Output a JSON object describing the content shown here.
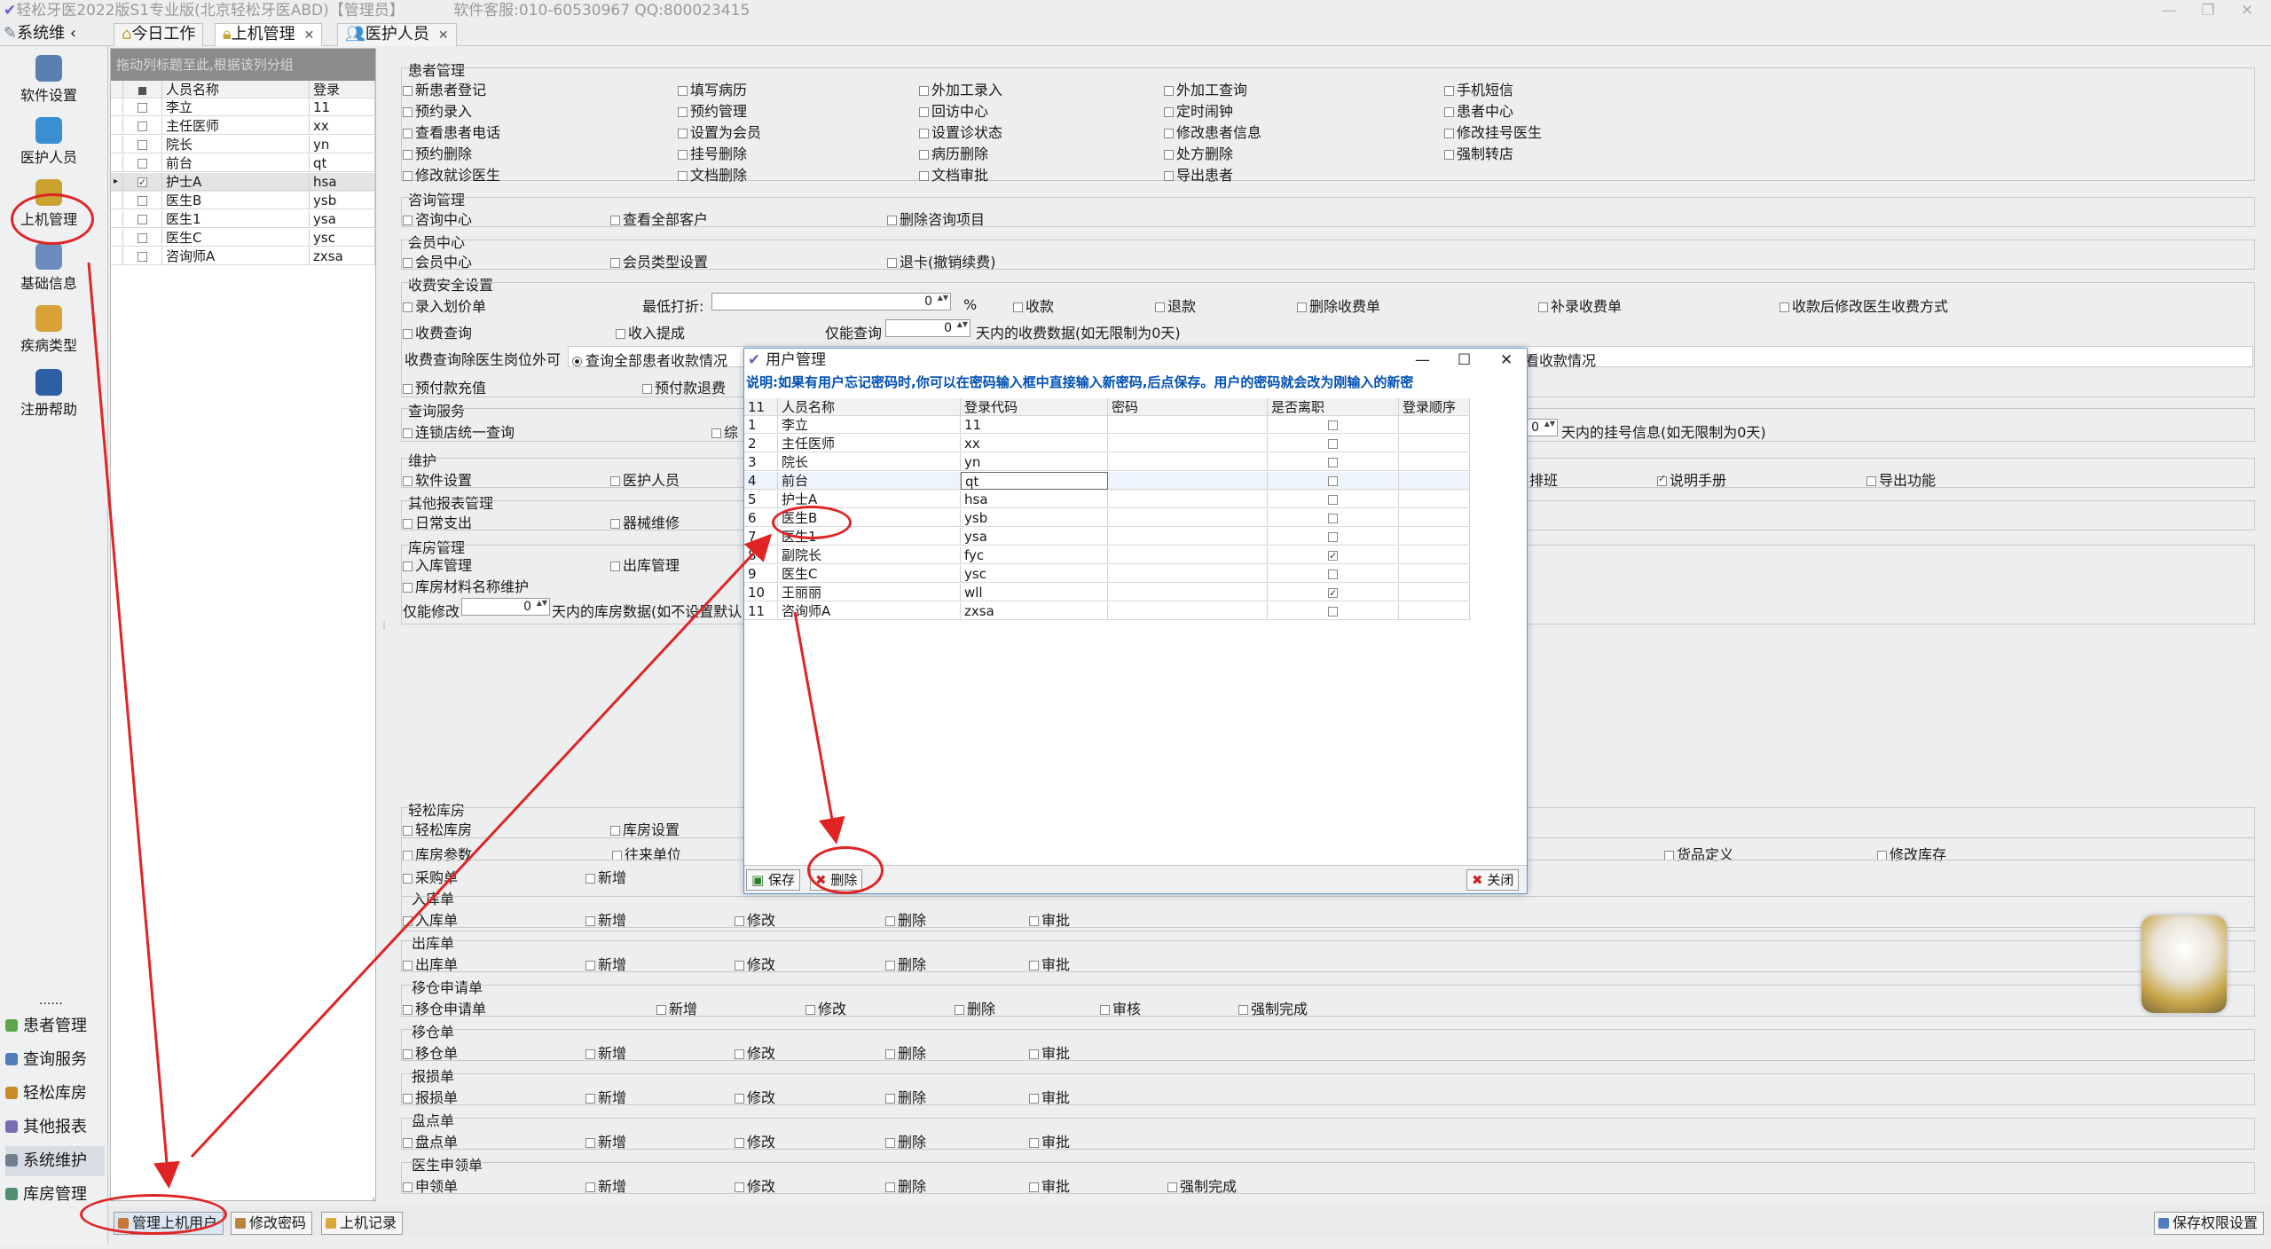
{
  "app": {
    "title": "轻松牙医2022版S1专业版(北京轻松牙医ABD)【管理员】",
    "service": "软件客服:010-60530967 QQ:800023415",
    "tabs_head": "系统维",
    "tabs": [
      {
        "label": "今日工作",
        "closable": false
      },
      {
        "label": "上机管理",
        "closable": true
      },
      {
        "label": "医护人员",
        "closable": true
      }
    ],
    "window_controls": [
      "—",
      "❐",
      "✕"
    ]
  },
  "nav": {
    "top_items": [
      {
        "label": "软件设置",
        "icon": "gear-icon",
        "color": "#5a7fb0"
      },
      {
        "label": "医护人员",
        "icon": "users-icon",
        "color": "#3b8fd1"
      },
      {
        "label": "上机管理",
        "icon": "lock-icon",
        "color": "#c9a230"
      },
      {
        "label": "基础信息",
        "icon": "database-gear-icon",
        "color": "#6a8bbd"
      },
      {
        "label": "疾病类型",
        "icon": "boxes-icon",
        "color": "#d9a236"
      },
      {
        "label": "注册帮助",
        "icon": "help-icon",
        "color": "#2c5fa4"
      }
    ],
    "more": "......",
    "bottom_items": [
      {
        "label": "患者管理",
        "icon": "patients-icon",
        "color": "#5ea34a"
      },
      {
        "label": "查询服务",
        "icon": "search-icon",
        "color": "#4f7bbf"
      },
      {
        "label": "轻松库房",
        "icon": "warehouse-icon",
        "color": "#c98b2a"
      },
      {
        "label": "其他报表",
        "icon": "report-icon",
        "color": "#7b6bb0"
      },
      {
        "label": "系统维护",
        "icon": "tools-icon",
        "color": "#6f7f8f"
      },
      {
        "label": "库房管理",
        "icon": "inventory-icon",
        "color": "#4f8f6f"
      }
    ]
  },
  "userlist": {
    "group_hint": "拖动列标题至此,根据该列分组",
    "headers": [
      "人员名称",
      "登录"
    ],
    "rows": [
      {
        "name": "李立",
        "code": "11",
        "checked": false
      },
      {
        "name": "主任医师",
        "code": "xx",
        "checked": false
      },
      {
        "name": "院长",
        "code": "yn",
        "checked": false
      },
      {
        "name": "前台",
        "code": "qt",
        "checked": false
      },
      {
        "name": "护士A",
        "code": "hsa",
        "checked": true
      },
      {
        "name": "医生B",
        "code": "ysb",
        "checked": false
      },
      {
        "name": "医生1",
        "code": "ysa",
        "checked": false
      },
      {
        "name": "医生C",
        "code": "ysc",
        "checked": false
      },
      {
        "name": "咨询师A",
        "code": "zxsa",
        "checked": false
      }
    ]
  },
  "perms": {
    "patient": {
      "title": "患者管理",
      "rows": [
        [
          "新患者登记",
          "填写病历",
          "外加工录入",
          "外加工查询",
          "手机短信"
        ],
        [
          "预约录入",
          "预约管理",
          "回访中心",
          "定时闹钟",
          "患者中心"
        ],
        [
          "查看患者电话",
          "设置为会员",
          "设置诊状态",
          "修改患者信息",
          "修改挂号医生"
        ],
        [
          "预约删除",
          "挂号删除",
          "病历删除",
          "处方删除",
          "强制转店"
        ],
        [
          "修改就诊医生",
          "文档删除",
          "文档审批",
          "导出患者",
          ""
        ]
      ]
    },
    "consult": {
      "title": "咨询管理",
      "items": [
        "咨询中心",
        "查看全部客户",
        "删除咨询项目"
      ]
    },
    "member": {
      "title": "会员中心",
      "items": [
        "会员中心",
        "会员类型设置",
        "退卡(撤销续费)"
      ]
    },
    "fee": {
      "title": "收费安全设置",
      "row1": [
        "录入划价单",
        "最低打折:",
        "0",
        "%",
        "收款",
        "退款",
        "删除收费单",
        "补录收费单",
        "收款后修改医生收费方式"
      ],
      "row2": [
        "收费查询",
        "收入提成",
        "仅能查询",
        "0",
        "天内的收费数据(如无限制为0天)"
      ],
      "row3_label": "收费查询除医生岗位外可",
      "row3_opt": "查询全部患者收款情况",
      "row3_right": "看收款情况",
      "row4": [
        "预付款充值",
        "预付款退费"
      ]
    },
    "query": {
      "title": "查询服务",
      "items": [
        "连锁店统一查询",
        "综"
      ],
      "tail_value": "0",
      "tail": "天内的挂号信息(如无限制为0天)"
    },
    "maint": {
      "title": "维护",
      "items": [
        "软件设置",
        "医护人员"
      ],
      "right": [
        "排班",
        "说明手册",
        "导出功能"
      ]
    },
    "other": {
      "title": "其他报表管理",
      "items": [
        "日常支出",
        "器械维修"
      ]
    },
    "stock": {
      "title": "库房管理",
      "items": [
        "入库管理",
        "出库管理",
        "库房材料名称维护"
      ],
      "limit_label": "仅能修改",
      "limit_value": "0",
      "limit_tail": "天内的库房数据(如不设置默认"
    },
    "ware": {
      "title": "轻松库房",
      "items": [
        "轻松库房",
        "库房设置"
      ],
      "row2": [
        "库房参数",
        "往来单位",
        "货品定义",
        "修改库存"
      ],
      "row3": [
        "采购单",
        "新增"
      ]
    },
    "ware_groups": [
      {
        "title": "入库单",
        "items": [
          "入库单",
          "新增",
          "修改",
          "删除",
          "审批"
        ]
      },
      {
        "title": "出库单",
        "items": [
          "出库单",
          "新增",
          "修改",
          "删除",
          "审批"
        ]
      },
      {
        "title": "移仓申请单",
        "items": [
          "移仓申请单",
          "新增",
          "修改",
          "删除",
          "审核",
          "强制完成"
        ]
      },
      {
        "title": "移仓单",
        "items": [
          "移仓单",
          "新增",
          "修改",
          "删除",
          "审批"
        ]
      },
      {
        "title": "报损单",
        "items": [
          "报损单",
          "新增",
          "修改",
          "删除",
          "审批"
        ]
      },
      {
        "title": "盘点单",
        "items": [
          "盘点单",
          "新增",
          "修改",
          "删除",
          "审批"
        ]
      },
      {
        "title": "医生申领单",
        "items": [
          "申领单",
          "新增",
          "修改",
          "删除",
          "审批",
          "强制完成"
        ]
      }
    ]
  },
  "bottom": {
    "buttons": [
      "管理上机用户",
      "修改密码",
      "上机记录"
    ],
    "save": "保存权限设置"
  },
  "dialog": {
    "title": "用户管理",
    "notice": "说明:如果有用户忘记密码时,你可以在密码输入框中直接输入新密码,后点保存。用户的密码就会改为刚输入的新密",
    "count": "11",
    "headers": [
      "人员名称",
      "登录代码",
      "密码",
      "是否离职",
      "登录顺序"
    ],
    "rows": [
      {
        "no": "1",
        "name": "李立",
        "code": "11",
        "resigned": false
      },
      {
        "no": "2",
        "name": "主任医师",
        "code": "xx",
        "resigned": false
      },
      {
        "no": "3",
        "name": "院长",
        "code": "yn",
        "resigned": false
      },
      {
        "no": "4",
        "name": "前台",
        "code": "qt",
        "resigned": false
      },
      {
        "no": "5",
        "name": "护士A",
        "code": "hsa",
        "resigned": false
      },
      {
        "no": "6",
        "name": "医生B",
        "code": "ysb",
        "resigned": false
      },
      {
        "no": "7",
        "name": "医生1",
        "code": "ysa",
        "resigned": false
      },
      {
        "no": "8",
        "name": "副院长",
        "code": "fyc",
        "resigned": true
      },
      {
        "no": "9",
        "name": "医生C",
        "code": "ysc",
        "resigned": false
      },
      {
        "no": "10",
        "name": "王丽丽",
        "code": "wll",
        "resigned": true
      },
      {
        "no": "11",
        "name": "咨询师A",
        "code": "zxsa",
        "resigned": false
      }
    ],
    "buttons": {
      "save": "保存",
      "delete": "删除",
      "close": "关闭"
    },
    "controls": [
      "—",
      "☐",
      "✕"
    ]
  }
}
